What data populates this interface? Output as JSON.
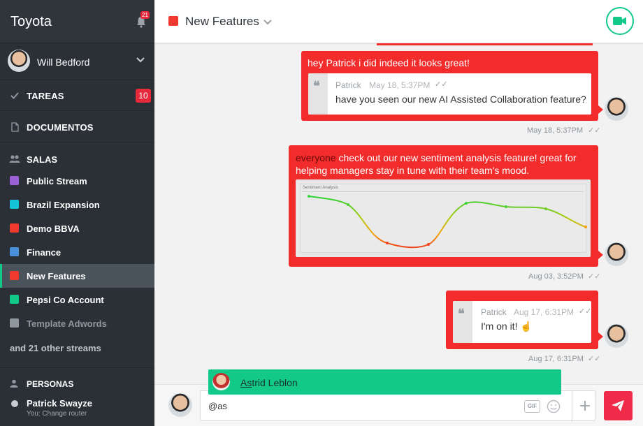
{
  "app": {
    "title": "Toyota",
    "notifications_count": "21"
  },
  "user": {
    "name": "Will Bedford"
  },
  "sidebar": {
    "tareas": {
      "label": "TAREAS",
      "count": "10"
    },
    "documentos": {
      "label": "DOCUMENTOS"
    },
    "salas": {
      "label": "SALAS"
    },
    "rooms": [
      {
        "name": "Public Stream",
        "color": "#9b5fd6"
      },
      {
        "name": "Brazil Expansion",
        "color": "#14c3d9"
      },
      {
        "name": "Demo BBVA",
        "color": "#f03a30"
      },
      {
        "name": "Finance",
        "color": "#4a8fd9"
      },
      {
        "name": "New Features",
        "color": "#f03a30"
      },
      {
        "name": "Pepsi Co Account",
        "color": "#12c98a"
      },
      {
        "name": "Template Adwords",
        "color": "#8e969e"
      }
    ],
    "more_streams": "and 21 other streams",
    "personas": {
      "label": "PERSONAS",
      "person_name": "Patrick Swayze",
      "person_status": "You: Change router"
    }
  },
  "header": {
    "room_name": "New Features",
    "room_color": "#f03a30",
    "accent": "#12c98a"
  },
  "messages": [
    {
      "text": "hey Patrick i did indeed it looks great!",
      "quote": {
        "author": "Patrick",
        "time": "May 18, 5:37PM",
        "text": "have you seen our new AI Assisted Collaboration feature?"
      },
      "timestamp": "May 18, 5:37PM"
    },
    {
      "mention": "everyone",
      "text": " check out our new sentiment analysis feature! great for helping managers stay in tune with their team's mood.",
      "attachment_title": "Sentiment Analysis",
      "timestamp": "Aug 03, 3:52PM"
    },
    {
      "quote": {
        "author": "Patrick",
        "time": "Aug 17, 6:31PM",
        "text": "I'm on it! ☝"
      },
      "timestamp": "Aug 17, 6:31PM"
    }
  ],
  "suggestion": {
    "match": "As",
    "rest": "trid Leblon"
  },
  "composer": {
    "value": "@as",
    "gif_label": "GIF"
  },
  "colors": {
    "message_bg": "#f22b2b",
    "send_button": "#f02b4a"
  }
}
